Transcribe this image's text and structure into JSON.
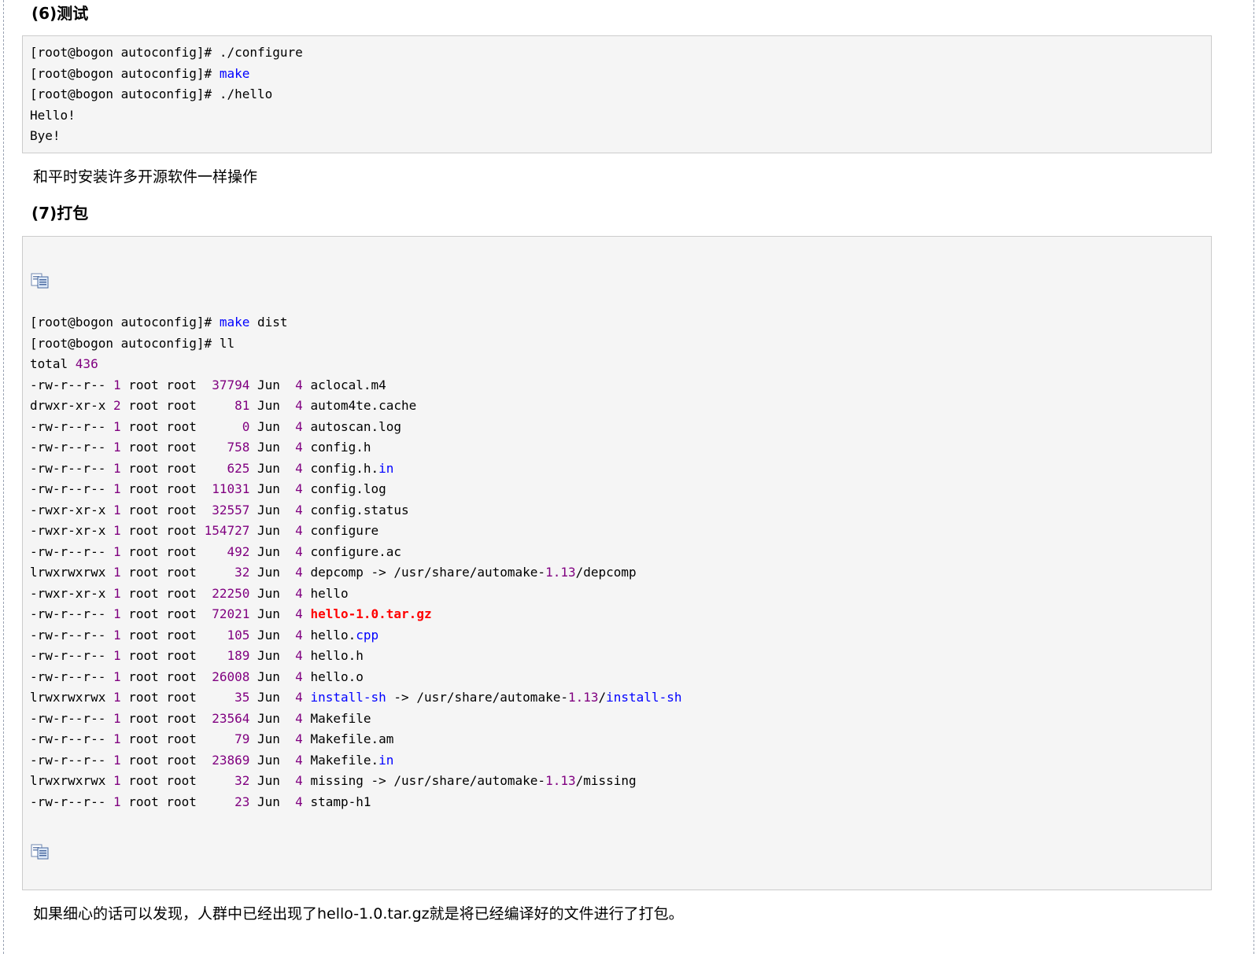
{
  "section6": {
    "heading": "(6)测试",
    "code": [
      [
        {
          "t": "[root@bogon autoconfig]# ./configure"
        }
      ],
      [
        {
          "t": "[root@bogon autoconfig]# "
        },
        {
          "t": "make",
          "c": "kw"
        }
      ],
      [
        {
          "t": "[root@bogon autoconfig]# ./hello"
        }
      ],
      [
        {
          "t": "Hello!"
        }
      ],
      [
        {
          "t": "Bye!"
        }
      ]
    ],
    "note": "和平时安装许多开源软件一样操作"
  },
  "section7": {
    "heading": "(7)打包",
    "copy_icon": "copy-code-icon",
    "code": [
      [
        {
          "t": "[root@bogon autoconfig]# "
        },
        {
          "t": "make",
          "c": "kw"
        },
        {
          "t": " dist"
        }
      ],
      [
        {
          "t": "[root@bogon autoconfig]# ll"
        }
      ],
      [
        {
          "t": "total "
        },
        {
          "t": "436",
          "c": "num"
        }
      ],
      [
        {
          "t": "-rw-r--r-- "
        },
        {
          "t": "1",
          "c": "num"
        },
        {
          "t": " root root  "
        },
        {
          "t": "37794",
          "c": "num"
        },
        {
          "t": " Jun  "
        },
        {
          "t": "4",
          "c": "num"
        },
        {
          "t": " aclocal.m4"
        }
      ],
      [
        {
          "t": "drwxr-xr-x "
        },
        {
          "t": "2",
          "c": "num"
        },
        {
          "t": " root root     "
        },
        {
          "t": "81",
          "c": "num"
        },
        {
          "t": " Jun  "
        },
        {
          "t": "4",
          "c": "num"
        },
        {
          "t": " autom4te.cache"
        }
      ],
      [
        {
          "t": "-rw-r--r-- "
        },
        {
          "t": "1",
          "c": "num"
        },
        {
          "t": " root root      "
        },
        {
          "t": "0",
          "c": "num"
        },
        {
          "t": " Jun  "
        },
        {
          "t": "4",
          "c": "num"
        },
        {
          "t": " autoscan.log"
        }
      ],
      [
        {
          "t": "-rw-r--r-- "
        },
        {
          "t": "1",
          "c": "num"
        },
        {
          "t": " root root    "
        },
        {
          "t": "758",
          "c": "num"
        },
        {
          "t": " Jun  "
        },
        {
          "t": "4",
          "c": "num"
        },
        {
          "t": " config.h"
        }
      ],
      [
        {
          "t": "-rw-r--r-- "
        },
        {
          "t": "1",
          "c": "num"
        },
        {
          "t": " root root    "
        },
        {
          "t": "625",
          "c": "num"
        },
        {
          "t": " Jun  "
        },
        {
          "t": "4",
          "c": "num"
        },
        {
          "t": " config.h."
        },
        {
          "t": "in",
          "c": "kw"
        }
      ],
      [
        {
          "t": "-rw-r--r-- "
        },
        {
          "t": "1",
          "c": "num"
        },
        {
          "t": " root root  "
        },
        {
          "t": "11031",
          "c": "num"
        },
        {
          "t": " Jun  "
        },
        {
          "t": "4",
          "c": "num"
        },
        {
          "t": " config.log"
        }
      ],
      [
        {
          "t": "-rwxr-xr-x "
        },
        {
          "t": "1",
          "c": "num"
        },
        {
          "t": " root root  "
        },
        {
          "t": "32557",
          "c": "num"
        },
        {
          "t": " Jun  "
        },
        {
          "t": "4",
          "c": "num"
        },
        {
          "t": " config.status"
        }
      ],
      [
        {
          "t": "-rwxr-xr-x "
        },
        {
          "t": "1",
          "c": "num"
        },
        {
          "t": " root root "
        },
        {
          "t": "154727",
          "c": "num"
        },
        {
          "t": " Jun  "
        },
        {
          "t": "4",
          "c": "num"
        },
        {
          "t": " configure"
        }
      ],
      [
        {
          "t": "-rw-r--r-- "
        },
        {
          "t": "1",
          "c": "num"
        },
        {
          "t": " root root    "
        },
        {
          "t": "492",
          "c": "num"
        },
        {
          "t": " Jun  "
        },
        {
          "t": "4",
          "c": "num"
        },
        {
          "t": " configure.ac"
        }
      ],
      [
        {
          "t": "lrwxrwxrwx "
        },
        {
          "t": "1",
          "c": "num"
        },
        {
          "t": " root root     "
        },
        {
          "t": "32",
          "c": "num"
        },
        {
          "t": " Jun  "
        },
        {
          "t": "4",
          "c": "num"
        },
        {
          "t": " depcomp -> /usr/share/automake-"
        },
        {
          "t": "1.13",
          "c": "num"
        },
        {
          "t": "/depcomp"
        }
      ],
      [
        {
          "t": "-rwxr-xr-x "
        },
        {
          "t": "1",
          "c": "num"
        },
        {
          "t": " root root  "
        },
        {
          "t": "22250",
          "c": "num"
        },
        {
          "t": " Jun  "
        },
        {
          "t": "4",
          "c": "num"
        },
        {
          "t": " hello"
        }
      ],
      [
        {
          "t": "-rw-r--r-- "
        },
        {
          "t": "1",
          "c": "num"
        },
        {
          "t": " root root  "
        },
        {
          "t": "72021",
          "c": "num"
        },
        {
          "t": " Jun  "
        },
        {
          "t": "4",
          "c": "num"
        },
        {
          "t": " "
        },
        {
          "t": "hello-1.0.tar.gz",
          "c": "hl"
        }
      ],
      [
        {
          "t": "-rw-r--r-- "
        },
        {
          "t": "1",
          "c": "num"
        },
        {
          "t": " root root    "
        },
        {
          "t": "105",
          "c": "num"
        },
        {
          "t": " Jun  "
        },
        {
          "t": "4",
          "c": "num"
        },
        {
          "t": " hello."
        },
        {
          "t": "cpp",
          "c": "kw"
        }
      ],
      [
        {
          "t": "-rw-r--r-- "
        },
        {
          "t": "1",
          "c": "num"
        },
        {
          "t": " root root    "
        },
        {
          "t": "189",
          "c": "num"
        },
        {
          "t": " Jun  "
        },
        {
          "t": "4",
          "c": "num"
        },
        {
          "t": " hello.h"
        }
      ],
      [
        {
          "t": "-rw-r--r-- "
        },
        {
          "t": "1",
          "c": "num"
        },
        {
          "t": " root root  "
        },
        {
          "t": "26008",
          "c": "num"
        },
        {
          "t": " Jun  "
        },
        {
          "t": "4",
          "c": "num"
        },
        {
          "t": " hello.o"
        }
      ],
      [
        {
          "t": "lrwxrwxrwx "
        },
        {
          "t": "1",
          "c": "num"
        },
        {
          "t": " root root     "
        },
        {
          "t": "35",
          "c": "num"
        },
        {
          "t": " Jun  "
        },
        {
          "t": "4",
          "c": "num"
        },
        {
          "t": " "
        },
        {
          "t": "install-sh",
          "c": "kw"
        },
        {
          "t": " -> /usr/share/automake-"
        },
        {
          "t": "1.13",
          "c": "num"
        },
        {
          "t": "/"
        },
        {
          "t": "install-sh",
          "c": "kw"
        }
      ],
      [
        {
          "t": "-rw-r--r-- "
        },
        {
          "t": "1",
          "c": "num"
        },
        {
          "t": " root root  "
        },
        {
          "t": "23564",
          "c": "num"
        },
        {
          "t": " Jun  "
        },
        {
          "t": "4",
          "c": "num"
        },
        {
          "t": " Makefile"
        }
      ],
      [
        {
          "t": "-rw-r--r-- "
        },
        {
          "t": "1",
          "c": "num"
        },
        {
          "t": " root root     "
        },
        {
          "t": "79",
          "c": "num"
        },
        {
          "t": " Jun  "
        },
        {
          "t": "4",
          "c": "num"
        },
        {
          "t": " Makefile.am"
        }
      ],
      [
        {
          "t": "-rw-r--r-- "
        },
        {
          "t": "1",
          "c": "num"
        },
        {
          "t": " root root  "
        },
        {
          "t": "23869",
          "c": "num"
        },
        {
          "t": " Jun  "
        },
        {
          "t": "4",
          "c": "num"
        },
        {
          "t": " Makefile."
        },
        {
          "t": "in",
          "c": "kw"
        }
      ],
      [
        {
          "t": "lrwxrwxrwx "
        },
        {
          "t": "1",
          "c": "num"
        },
        {
          "t": " root root     "
        },
        {
          "t": "32",
          "c": "num"
        },
        {
          "t": " Jun  "
        },
        {
          "t": "4",
          "c": "num"
        },
        {
          "t": " missing -> /usr/share/automake-"
        },
        {
          "t": "1.13",
          "c": "num"
        },
        {
          "t": "/missing"
        }
      ],
      [
        {
          "t": "-rw-r--r-- "
        },
        {
          "t": "1",
          "c": "num"
        },
        {
          "t": " root root     "
        },
        {
          "t": "23",
          "c": "num"
        },
        {
          "t": " Jun  "
        },
        {
          "t": "4",
          "c": "num"
        },
        {
          "t": " stamp-h1"
        }
      ]
    ],
    "note": "如果细心的话可以发现，人群中已经出现了hello-1.0.tar.gz就是将已经编译好的文件进行了打包。"
  },
  "colors": {
    "code_background": "#f5f5f5",
    "keyword": "#0000ff",
    "number": "#800080",
    "highlight": "#ff0000"
  }
}
